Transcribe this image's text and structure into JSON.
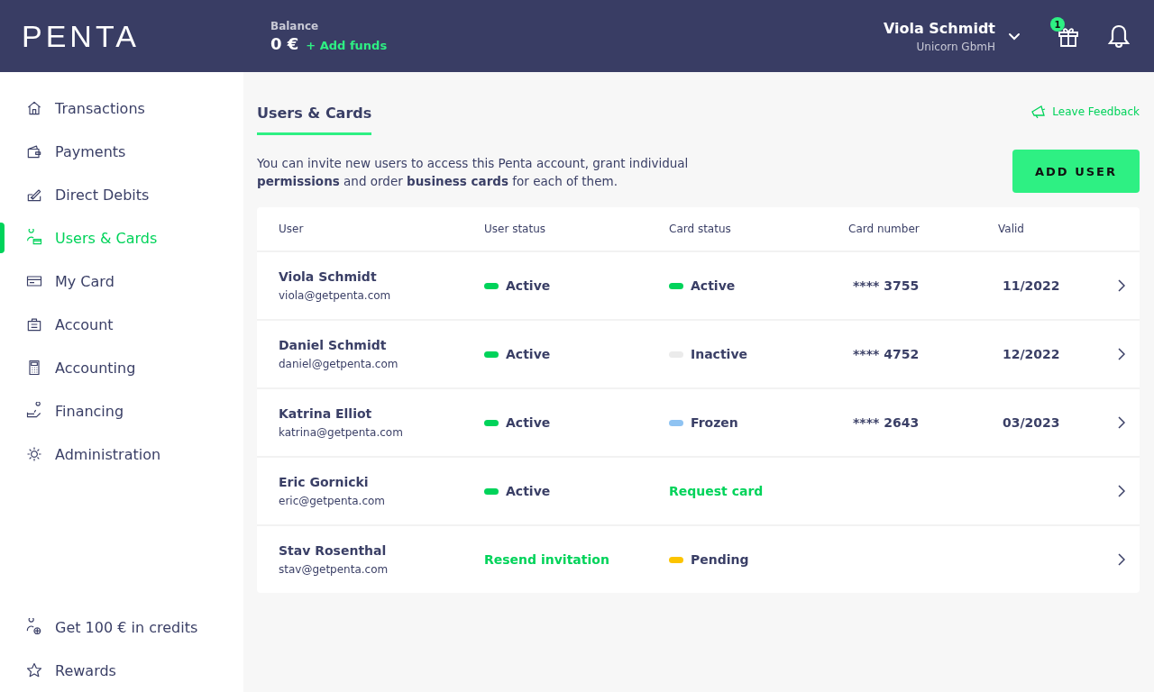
{
  "header": {
    "logo": "PENTA",
    "balance_label": "Balance",
    "balance": "0 €",
    "add_funds": "+ Add funds",
    "user_name": "Viola Schmidt",
    "company": "Unicorn GbmH",
    "gift_badge": "1"
  },
  "sidebar": {
    "items": [
      {
        "label": "Transactions",
        "selected": false
      },
      {
        "label": "Payments",
        "selected": false
      },
      {
        "label": "Direct Debits",
        "selected": false
      },
      {
        "label": "Users & Cards",
        "selected": true
      },
      {
        "label": "My Card",
        "selected": false
      },
      {
        "label": "Account",
        "selected": false
      },
      {
        "label": "Accounting",
        "selected": false
      },
      {
        "label": "Financing",
        "selected": false
      },
      {
        "label": "Administration",
        "selected": false
      }
    ],
    "footer_items": [
      {
        "label": "Get 100 € in credits"
      },
      {
        "label": "Rewards"
      }
    ]
  },
  "page": {
    "tab": "Users & Cards",
    "feedback": "Leave Feedback",
    "intro": "You can invite new users to access this Penta account, grant individual **permissions** and order **business cards** for each of them.",
    "add_button": "ADD USER"
  },
  "table": {
    "columns": [
      "User",
      "User status",
      "Card status",
      "Card number",
      "Valid"
    ],
    "rows": [
      {
        "name": "Viola Schmidt",
        "email": "viola@getpenta.com",
        "user_status": {
          "kind": "status",
          "text": "Active",
          "color": "#00d35a"
        },
        "card_status": {
          "kind": "status",
          "text": "Active",
          "color": "#00d35a"
        },
        "card_number": "**** 3755",
        "valid": "11/2022"
      },
      {
        "name": "Daniel Schmidt",
        "email": "daniel@getpenta.com",
        "user_status": {
          "kind": "status",
          "text": "Active",
          "color": "#00d35a"
        },
        "card_status": {
          "kind": "status",
          "text": "Inactive",
          "color": "#ebebeb"
        },
        "card_number": "**** 4752",
        "valid": "12/2022"
      },
      {
        "name": "Katrina Elliot",
        "email": "katrina@getpenta.com",
        "user_status": {
          "kind": "status",
          "text": "Active",
          "color": "#00d35a"
        },
        "card_status": {
          "kind": "status",
          "text": "Frozen",
          "color": "#8fc3f2"
        },
        "card_number": "**** 2643",
        "valid": "03/2023"
      },
      {
        "name": "Eric Gornicki",
        "email": "eric@getpenta.com",
        "user_status": {
          "kind": "status",
          "text": "Active",
          "color": "#00d35a"
        },
        "card_status": {
          "kind": "link",
          "text": "Request card"
        }
      },
      {
        "name": "Stav Rosenthal",
        "email": "stav@getpenta.com",
        "user_status": {
          "kind": "link",
          "text": "Resend invitation"
        },
        "card_status": {
          "kind": "status",
          "text": "Pending",
          "color": "#fcc400"
        }
      }
    ]
  }
}
